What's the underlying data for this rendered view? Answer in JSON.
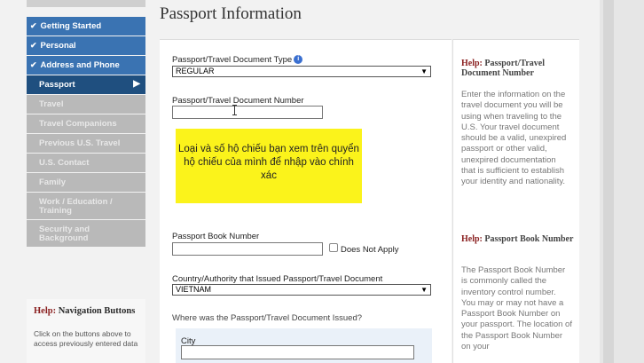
{
  "sidebar": {
    "items": [
      {
        "label": "Getting Started",
        "state": "done"
      },
      {
        "label": "Personal",
        "state": "done"
      },
      {
        "label": "Address and Phone",
        "state": "done"
      },
      {
        "label": "Passport",
        "state": "active"
      },
      {
        "label": "Travel",
        "state": "inactive"
      },
      {
        "label": "Travel Companions",
        "state": "inactive"
      },
      {
        "label": "Previous U.S. Travel",
        "state": "inactive"
      },
      {
        "label": "U.S. Contact",
        "state": "inactive"
      },
      {
        "label": "Family",
        "state": "inactive"
      },
      {
        "label": "Work / Education / Training",
        "state": "inactive"
      },
      {
        "label": "Security and Background",
        "state": "inactive"
      }
    ],
    "help": {
      "title_prefix": "Help:",
      "title": "Navigation Buttons",
      "body": "Click on the buttons above to access previously entered data"
    }
  },
  "page": {
    "title": "Passport Information"
  },
  "form": {
    "doc_type_label": "Passport/Travel Document Type",
    "doc_type_value": "REGULAR",
    "doc_number_label": "Passport/Travel Document Number",
    "note": "Loại và số hộ chiếu bạn xem trên quyển hộ chiếu của mình để nhập vào chính xác",
    "book_number_label": "Passport Book Number",
    "does_not_apply_label": "Does Not Apply",
    "issuing_country_label": "Country/Authority that Issued Passport/Travel Document",
    "issuing_country_value": "VIETNAM",
    "issued_where_label": "Where was the Passport/Travel Document Issued?",
    "city_label": "City"
  },
  "help": {
    "doc": {
      "prefix": "Help:",
      "title": "Passport/Travel Document Number",
      "body": "Enter the information on the travel document you will be using when traveling to the U.S. Your travel document should be a valid, unexpired passport or other valid, unexpired documentation that is sufficient to establish your identity and nationality."
    },
    "book": {
      "prefix": "Help:",
      "title": "Passport Book Number",
      "body": "The Passport Book Number is commonly called the inventory control number. You may or may not have a Passport Book Number on your passport. The location of the Passport Book Number on your"
    }
  },
  "colors": {
    "nav_done": "#3a73b2",
    "nav_active": "#1f4f7f",
    "nav_inactive": "#b9b9b9",
    "note_bg": "#fbf31b",
    "help_accent": "#8a1f1f"
  }
}
